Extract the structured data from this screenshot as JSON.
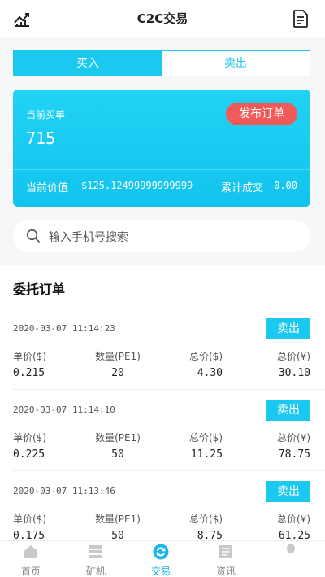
{
  "header": {
    "title": "C2C交易",
    "left_icon": "chart-icon",
    "right_icon": "document-icon"
  },
  "tabs": [
    {
      "label": "买入",
      "active": true
    },
    {
      "label": "卖出",
      "active": false
    }
  ],
  "card": {
    "buy_label": "当前买单",
    "buy_count": "715",
    "publish_label": "发布订单",
    "price_label": "当前价值",
    "price_value": "$125.12499999999999",
    "total_label": "累计成交",
    "total_value": "0.00"
  },
  "search": {
    "placeholder": "输入手机号搜索"
  },
  "orders_section": {
    "title": "委托订单",
    "columns": [
      "单价($)",
      "数量(PE1)",
      "总价($)",
      "总价(¥)"
    ],
    "sell_label": "卖出",
    "rows": [
      {
        "date": "2020-03-07 11:14:23",
        "unit_price": "0.215",
        "quantity": "20",
        "total_usd": "4.30",
        "total_cny": "30.10"
      },
      {
        "date": "2020-03-07 11:14:10",
        "unit_price": "0.225",
        "quantity": "50",
        "total_usd": "11.25",
        "total_cny": "78.75"
      },
      {
        "date": "2020-03-07 11:13:46",
        "unit_price": "0.175",
        "quantity": "50",
        "total_usd": "8.75",
        "total_cny": "61.25"
      }
    ]
  },
  "tabbar": [
    {
      "label": "首页",
      "icon": "home-icon",
      "active": false
    },
    {
      "label": "矿机",
      "icon": "server-icon",
      "active": false
    },
    {
      "label": "交易",
      "icon": "exchange-icon",
      "active": true
    },
    {
      "label": "资讯",
      "icon": "news-icon",
      "active": false
    },
    {
      "label": "",
      "icon": "user-icon",
      "active": false
    }
  ],
  "colors": {
    "accent": "#1ac8f0",
    "publish_button": "#f25a5a",
    "tab_active": "#1ab8e8"
  }
}
